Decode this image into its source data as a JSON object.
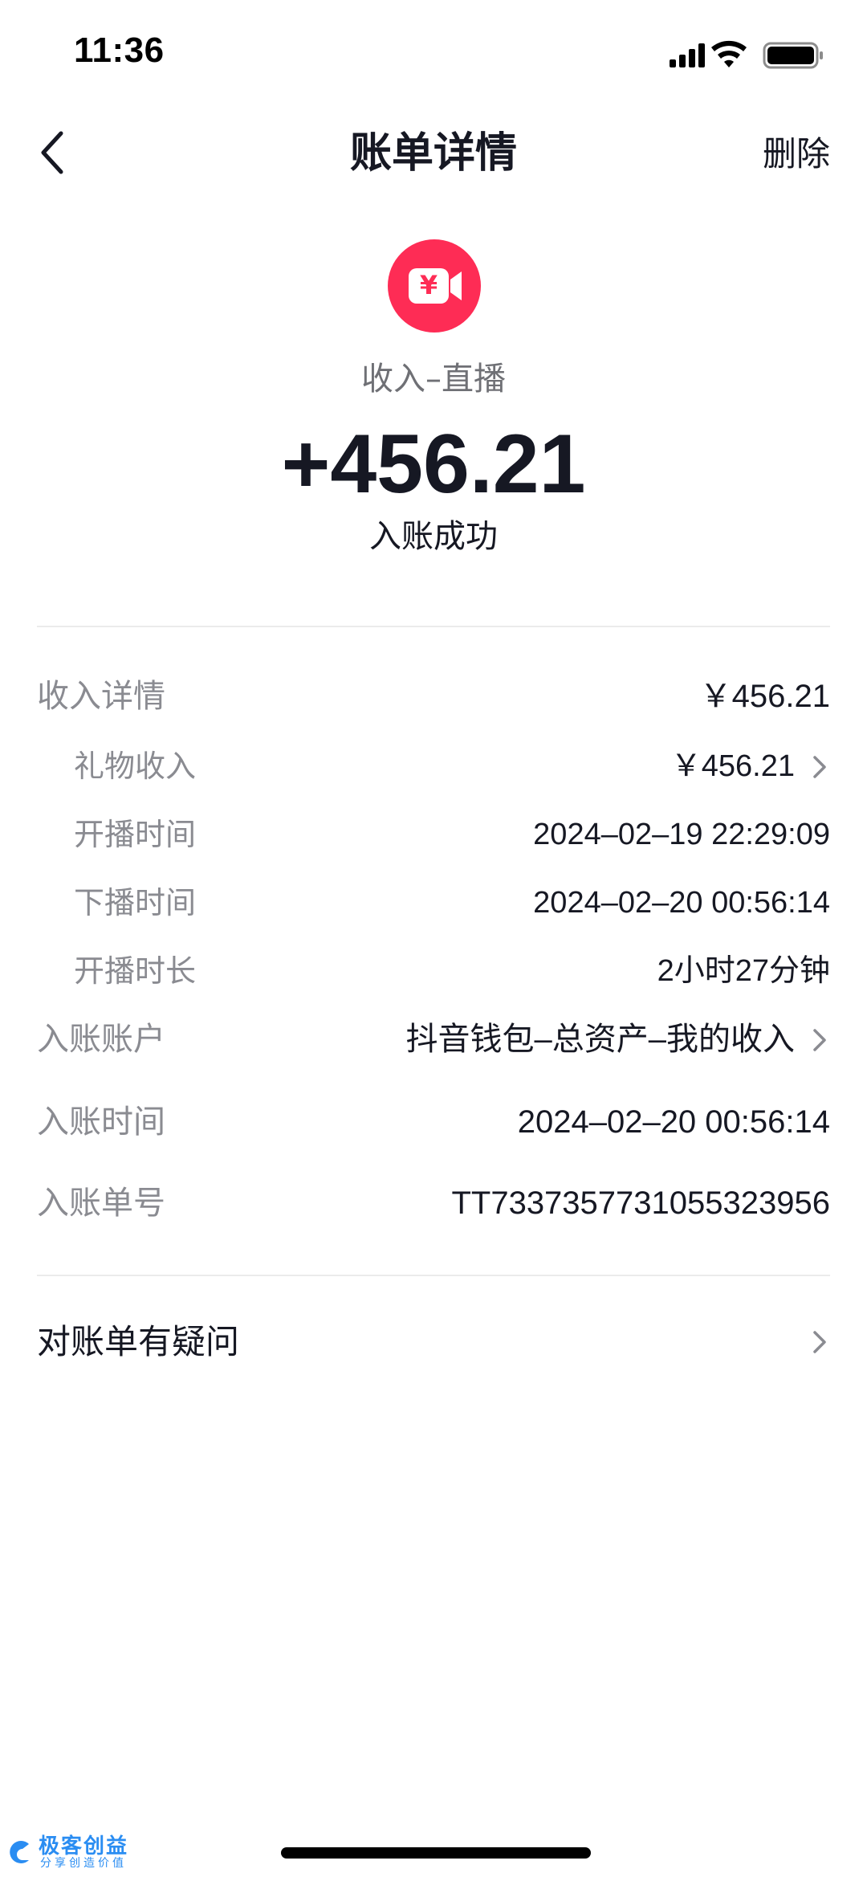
{
  "status_bar": {
    "time": "11:36"
  },
  "nav": {
    "title": "账单详情",
    "action": "删除"
  },
  "hero": {
    "type_label": "收入–直播",
    "amount": "+456.21",
    "status": "入账成功",
    "icon_color": "#fe2c55"
  },
  "details": {
    "income_detail": {
      "label": "收入详情",
      "value": "￥456.21"
    },
    "gift_income": {
      "label": "礼物收入",
      "value": "￥456.21"
    },
    "start_time": {
      "label": "开播时间",
      "value": "2024–02–19 22:29:09"
    },
    "end_time": {
      "label": "下播时间",
      "value": "2024–02–20 00:56:14"
    },
    "duration": {
      "label": "开播时长",
      "value": "2小时27分钟"
    },
    "account": {
      "label": "入账账户",
      "value": "抖音钱包–总资产–我的收入"
    },
    "credit_time": {
      "label": "入账时间",
      "value": "2024–02–20 00:56:14"
    },
    "order_no": {
      "label": "入账单号",
      "value": "TT7337357731055323956"
    }
  },
  "question": {
    "label": "对账单有疑问"
  },
  "watermark": {
    "text": "极客创益",
    "sub": "分享创造价值"
  }
}
